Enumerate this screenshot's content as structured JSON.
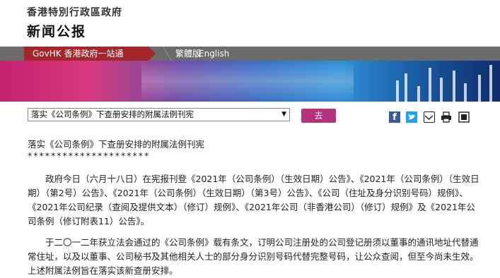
{
  "header": {
    "gov_name": "香港特別行政區政府",
    "section_title": "新闻公报"
  },
  "nav": {
    "govhk": "GovHK 香港政府一站通",
    "traditional": "繁體版",
    "english": "English"
  },
  "toolbar": {
    "select_value": "落实《公司条例》下查册安排的附属法例刊宪",
    "go_label": "去"
  },
  "icons": [
    "facebook-icon",
    "twitter-icon",
    "mail-icon",
    "print-icon",
    "share-icon"
  ],
  "content": {
    "headline": "落实《公司条例》下查册安排的附属法例刊宪",
    "stars": "*********************",
    "para1": "政府今日（六月十八日）在宪报刊登《2021年（公司条例）（生效日期）公告》、《2021年（公司条例）（生效日期）（第2号）公告》、《2021年（公司条例）（生效日期）（第3号）公告》、《公司（住址及身分识别号码）规例》、《2021年公司纪录（查阅及提供文本）（修订）规例》、《2021年公司（非香港公司）（修订）规例》及《2021年公司条例（修订附表11）公告》。",
    "para2": "于二〇一二年获立法会通过的《公司条例》载有条文，订明公司注册处的公司登记册须以董事的通讯地址代替通常住址，以及以董事、公司秘书及其他相关人士的部分身分识别号码代替完整号码，让公众查阅，但至今尚未生效。上述附属法例旨在落实该新查册安排。"
  }
}
